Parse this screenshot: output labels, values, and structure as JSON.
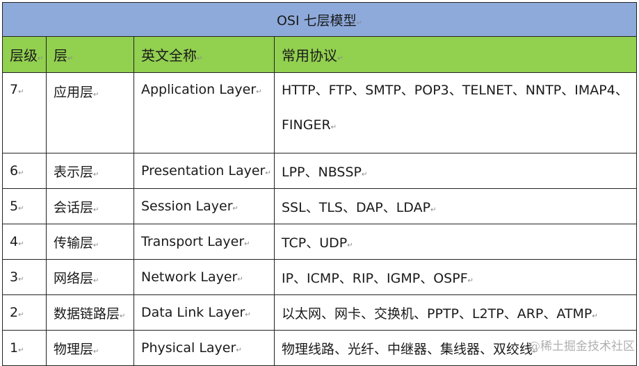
{
  "table": {
    "title": "OSI 七层模型",
    "headers": [
      "层级",
      "层",
      "英文全称",
      "常用协议"
    ],
    "rows": [
      {
        "level": "7",
        "layer": "应用层",
        "english": "Application Layer",
        "protocols": "HTTP、FTP、SMTP、POP3、TELNET、NNTP、IMAP4、FINGER"
      },
      {
        "level": "6",
        "layer": "表示层",
        "english": "Presentation Layer",
        "protocols": "LPP、NBSSP"
      },
      {
        "level": "5",
        "layer": "会话层",
        "english": "Session Layer",
        "protocols": "SSL、TLS、DAP、LDAP"
      },
      {
        "level": "4",
        "layer": "传输层",
        "english": "Transport Layer",
        "protocols": "TCP、UDP"
      },
      {
        "level": "3",
        "layer": "网络层",
        "english": "Network Layer",
        "protocols": "IP、ICMP、RIP、IGMP、OSPF"
      },
      {
        "level": "2",
        "layer": "数据链路层",
        "english": "Data Link Layer",
        "protocols": "以太网、网卡、交换机、PPTP、L2TP、ARP、ATMP"
      },
      {
        "level": "1",
        "layer": "物理层",
        "english": "Physical Layer",
        "protocols": "物理线路、光纤、中继器、集线器、双绞线"
      }
    ],
    "paragraph_mark": "↵"
  },
  "colors": {
    "title_bg": "#8eaadb",
    "header_bg": "#92d050"
  },
  "watermark": "@稀土掘金技术社区"
}
